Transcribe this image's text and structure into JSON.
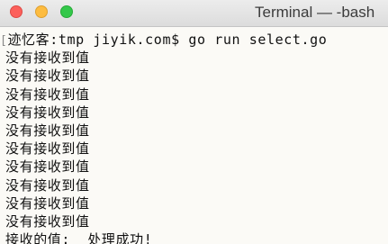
{
  "window": {
    "title": "Terminal — -bash"
  },
  "terminal": {
    "prompt_bracket": "[",
    "prompt_line": "迹忆客:tmp jiyik.com$ go run select.go",
    "output_lines": [
      "没有接收到值",
      "没有接收到值",
      "没有接收到值",
      "没有接收到值",
      "没有接收到值",
      "没有接收到值",
      "没有接收到值",
      "没有接收到值",
      "没有接收到值",
      "没有接收到值"
    ],
    "final_line": "接收的值:  处理成功!"
  }
}
